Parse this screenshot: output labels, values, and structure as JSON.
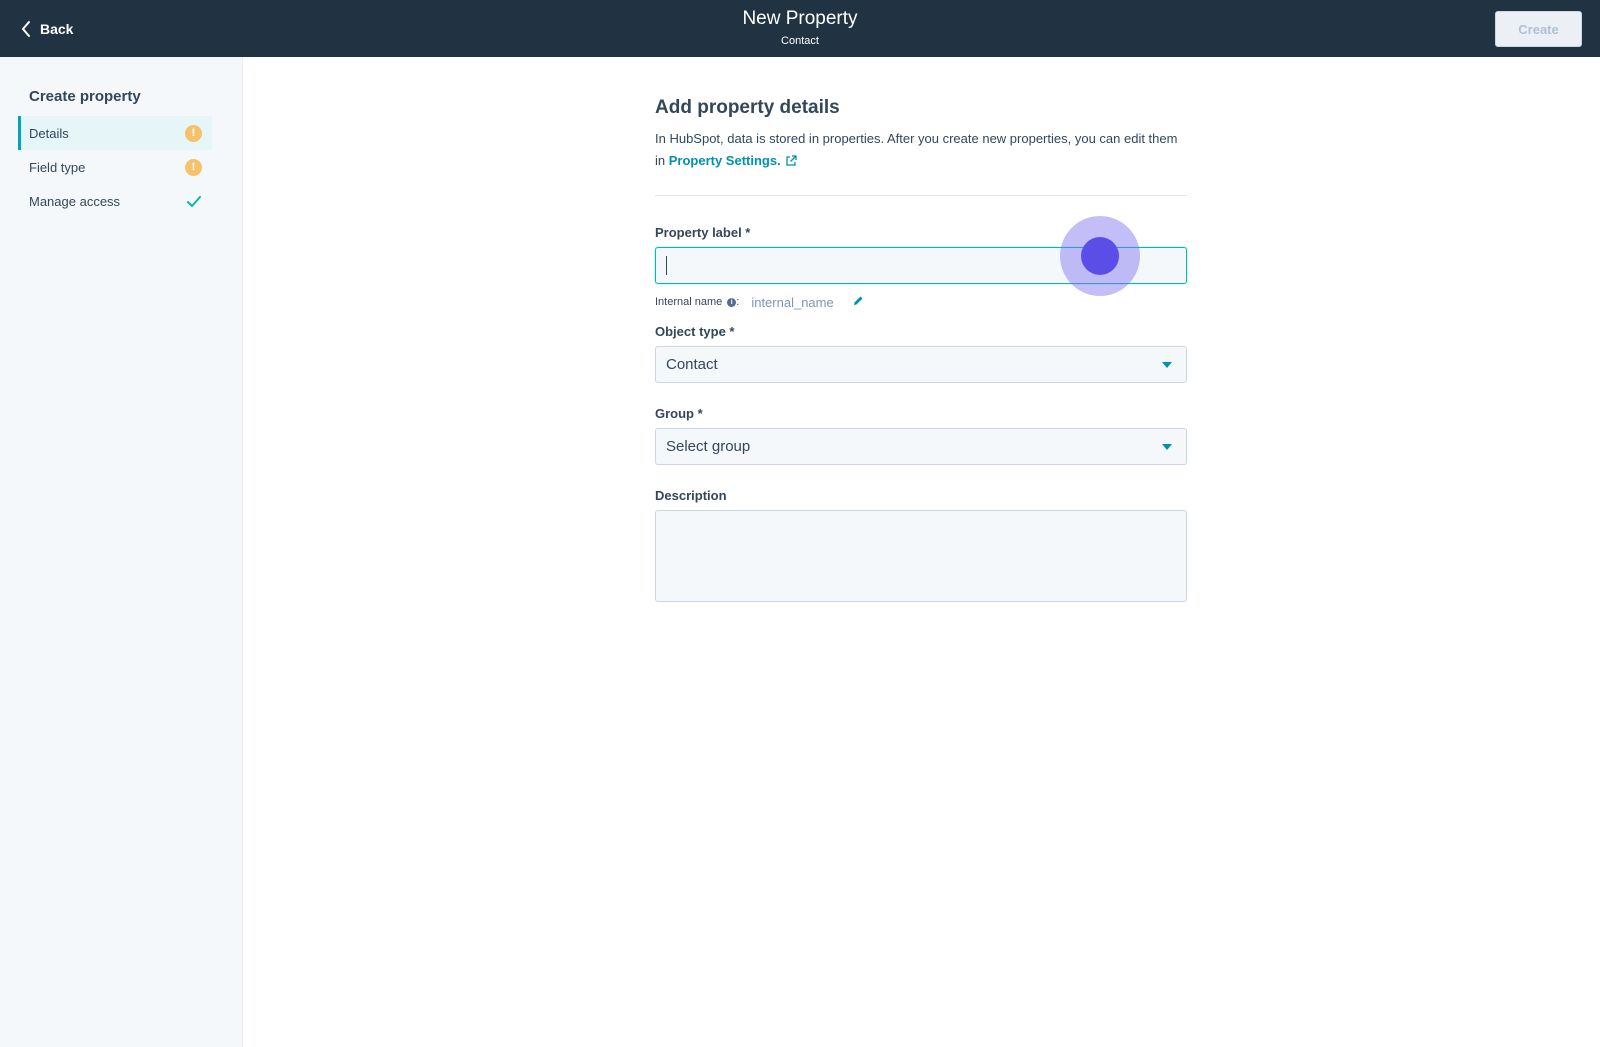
{
  "header": {
    "back_label": "Back",
    "title": "New Property",
    "subtitle": "Contact",
    "create_label": "Create"
  },
  "sidebar": {
    "title": "Create property",
    "steps": [
      {
        "label": "Details",
        "status": "warning",
        "active": true
      },
      {
        "label": "Field type",
        "status": "warning",
        "active": false
      },
      {
        "label": "Manage access",
        "status": "complete",
        "active": false
      }
    ]
  },
  "form": {
    "title": "Add property details",
    "description_prefix": "In HubSpot, data is stored in properties. After you create new properties, you can edit them in ",
    "description_link": "Property Settings.",
    "property_label": {
      "label": "Property label *",
      "value": ""
    },
    "internal_name": {
      "label": "Internal name",
      "value": "internal_name"
    },
    "object_type": {
      "label": "Object type *",
      "value": "Contact"
    },
    "group": {
      "label": "Group *",
      "value": "Select group"
    },
    "description": {
      "label": "Description",
      "value": ""
    }
  },
  "colors": {
    "topbar": "#213343",
    "accent": "#0091ae",
    "warning": "#f5c26b",
    "success": "#00bda5",
    "click_indicator": "#5b4ee8"
  },
  "icons": [
    "chevron-left-icon",
    "warning-icon",
    "checkmark-icon",
    "external-link-icon",
    "info-icon",
    "pencil-icon",
    "caret-down-icon"
  ]
}
